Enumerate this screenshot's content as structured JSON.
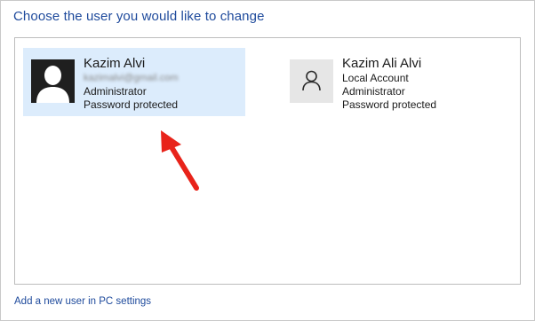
{
  "header": {
    "title": "Choose the user you would like to change"
  },
  "users": [
    {
      "name": "Kazim Alvi",
      "email": "kazimalvi@gmail.com",
      "role": "Administrator",
      "status": "Password protected",
      "avatar_icon": "user-photo-icon",
      "selected": true
    },
    {
      "name": "Kazim Ali Alvi",
      "account_type": "Local Account",
      "role": "Administrator",
      "status": "Password protected",
      "avatar_icon": "person-outline-icon",
      "selected": false
    }
  ],
  "footer": {
    "add_user_link": "Add a new user in PC settings"
  },
  "colors": {
    "title_link": "#1e4a9c",
    "selected_tile_bg": "#dcecfc",
    "arrow": "#e8231a"
  }
}
